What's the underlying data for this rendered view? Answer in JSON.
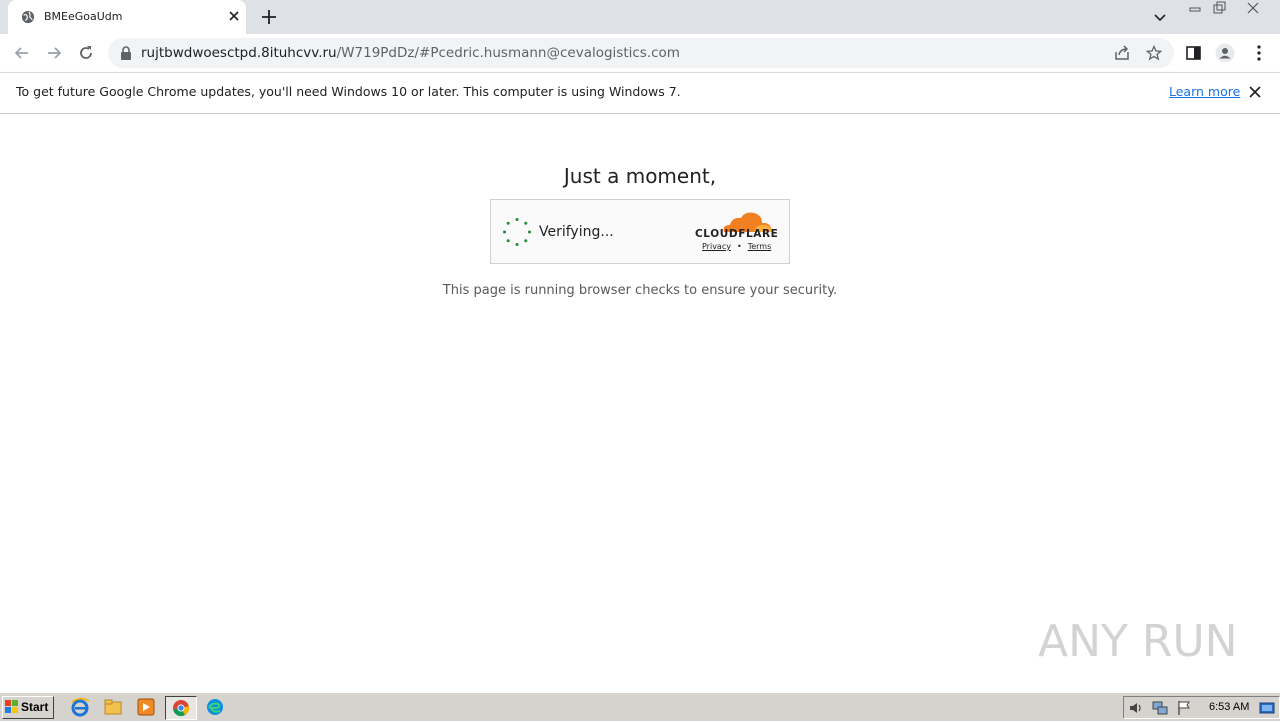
{
  "browser": {
    "tab": {
      "title": "BMEeGoaUdm"
    },
    "address": {
      "host": "rujtbwdwoesctpd.8ituhcvv.ru",
      "path": "/W719PdDz/#Pcedric.husmann@cevalogistics.com"
    }
  },
  "infobar": {
    "message": "To get future Google Chrome updates, you'll need Windows 10 or later. This computer is using Windows 7.",
    "link": "Learn more"
  },
  "page": {
    "heading": "Just a moment,",
    "widget": {
      "status": "Verifying...",
      "brand": "CLOUDFLARE",
      "privacy": "Privacy",
      "separator": "•",
      "terms": "Terms"
    },
    "subtext": "This page is running browser checks to ensure your security.",
    "watermark": "ANY RUN"
  },
  "taskbar": {
    "start": "Start",
    "time": "6:53 AM"
  },
  "colors": {
    "accent": "#1a73e8",
    "cloudflare_orange": "#f38020",
    "cloudflare_light": "#faae40",
    "spinner_green": "#1e8e3e"
  }
}
